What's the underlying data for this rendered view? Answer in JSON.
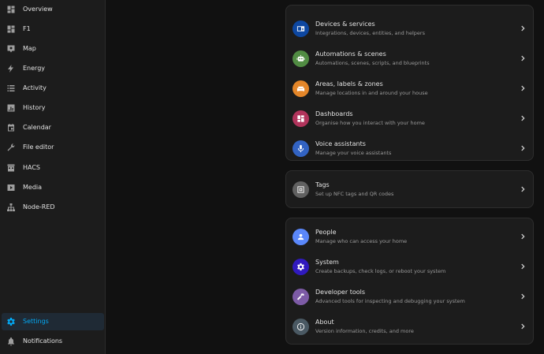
{
  "colors": {
    "accent": "#03a9f4",
    "sidebar_bg": "#1c1c1c",
    "main_bg": "#111111",
    "card_bg": "#1c1c1c"
  },
  "sidebar": {
    "items": [
      {
        "label": "Overview",
        "icon": "dashboard-grid-icon"
      },
      {
        "label": "F1",
        "icon": "dashboard-grid-icon"
      },
      {
        "label": "Map",
        "icon": "map-icon"
      },
      {
        "label": "Energy",
        "icon": "lightning-bolt-icon"
      },
      {
        "label": "Activity",
        "icon": "list-icon"
      },
      {
        "label": "History",
        "icon": "chart-box-icon"
      },
      {
        "label": "Calendar",
        "icon": "calendar-icon"
      },
      {
        "label": "File editor",
        "icon": "wrench-icon"
      },
      {
        "label": "HACS",
        "icon": "hacs-store-icon"
      },
      {
        "label": "Media",
        "icon": "play-box-icon"
      },
      {
        "label": "Node-RED",
        "icon": "sitemap-icon"
      }
    ],
    "settings": {
      "label": "Settings",
      "icon": "cog-icon",
      "active": true
    },
    "notifications": {
      "label": "Notifications",
      "icon": "bell-icon"
    }
  },
  "settings_groups": [
    [
      {
        "title": "Devices & services",
        "subtitle": "Integrations, devices, entities, and helpers",
        "icon": "devices-icon",
        "color": "#0d47a1"
      },
      {
        "title": "Automations & scenes",
        "subtitle": "Automations, scenes, scripts, and blueprints",
        "icon": "robot-icon",
        "color": "#518c43"
      },
      {
        "title": "Areas, labels & zones",
        "subtitle": "Manage locations in and around your house",
        "icon": "sofa-icon",
        "color": "#e48629"
      },
      {
        "title": "Dashboards",
        "subtitle": "Organise how you interact with your home",
        "icon": "view-dashboard-icon",
        "color": "#b1345c"
      },
      {
        "title": "Voice assistants",
        "subtitle": "Manage your voice assistants",
        "icon": "microphone-icon",
        "color": "#3263c3"
      }
    ],
    [
      {
        "title": "Tags",
        "subtitle": "Set up NFC tags and QR codes",
        "icon": "nfc-tag-icon",
        "color": "#616161"
      }
    ],
    [
      {
        "title": "People",
        "subtitle": "Manage who can access your home",
        "icon": "account-icon",
        "color": "#5a87fa"
      },
      {
        "title": "System",
        "subtitle": "Create backups, check logs, or reboot your system",
        "icon": "cog-icon",
        "color": "#301ABE"
      },
      {
        "title": "Developer tools",
        "subtitle": "Advanced tools for inspecting and debugging your system",
        "icon": "hammer-icon",
        "color": "#7D5BA6"
      },
      {
        "title": "About",
        "subtitle": "Version information, credits, and more",
        "icon": "info-icon",
        "color": "#4A5963"
      }
    ]
  ]
}
